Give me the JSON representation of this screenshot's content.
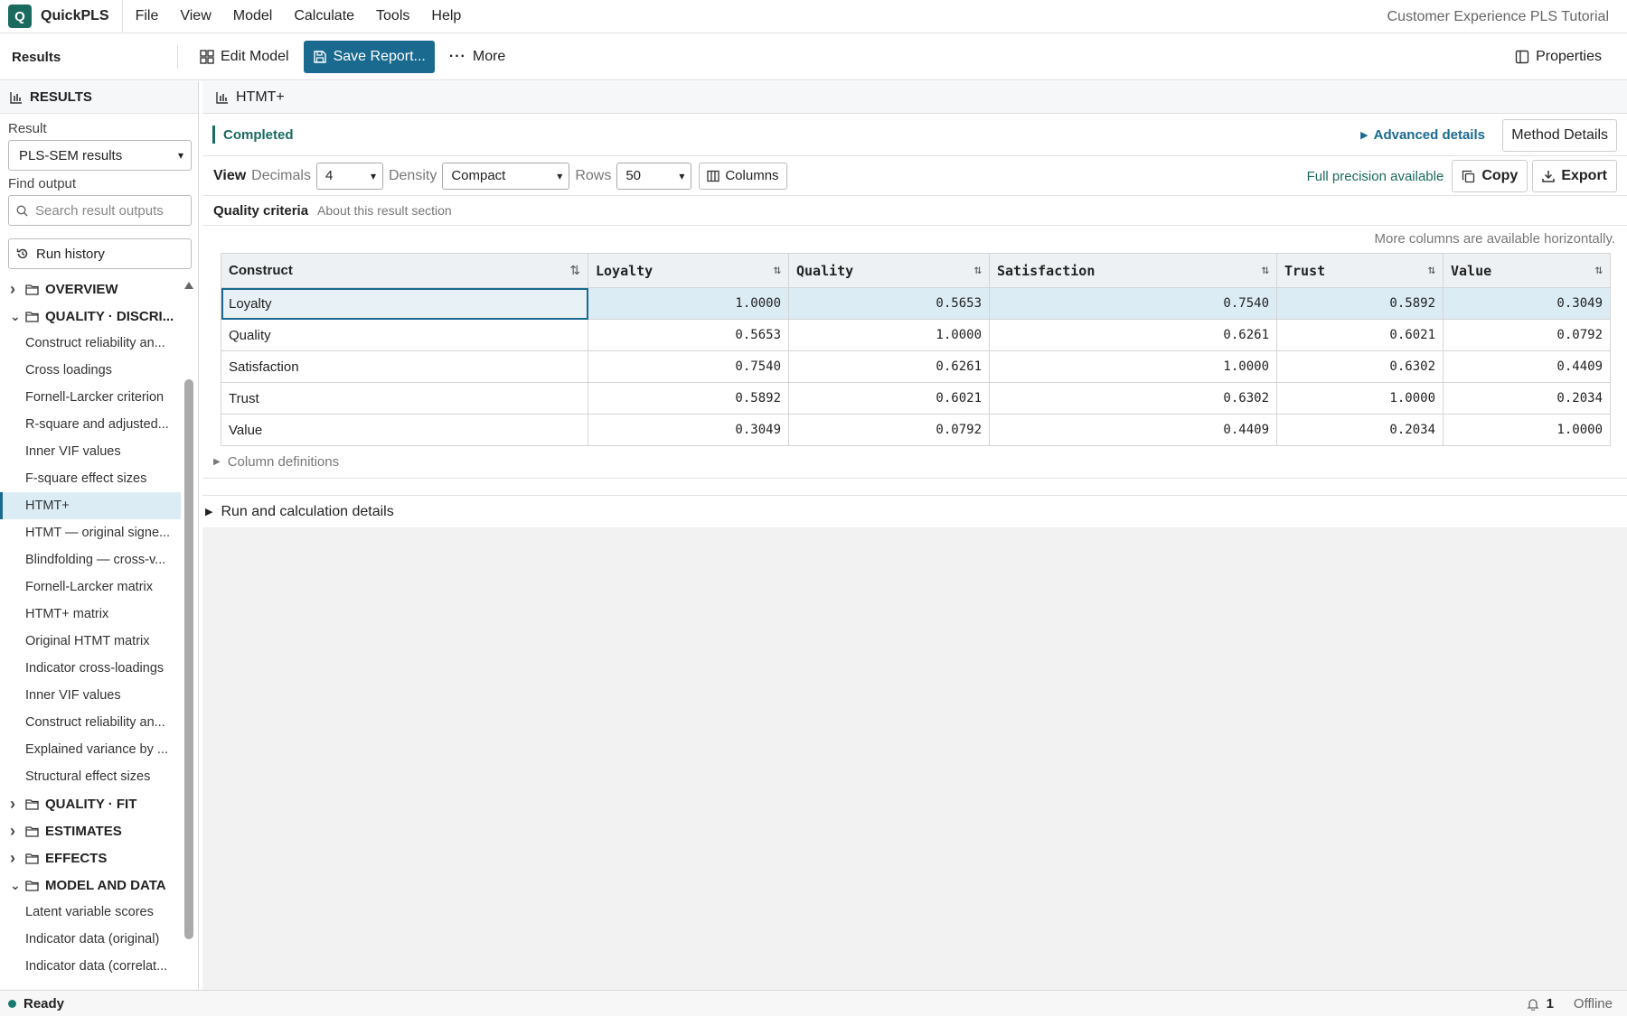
{
  "app": {
    "name": "QuickPLS",
    "logo_letter": "Q",
    "project_title": "Customer Experience PLS Tutorial"
  },
  "menu": [
    "File",
    "View",
    "Model",
    "Calculate",
    "Tools",
    "Help"
  ],
  "toolbar": {
    "title": "Results",
    "edit_model": "Edit Model",
    "save_report": "Save Report...",
    "more": "More",
    "properties": "Properties"
  },
  "sidebar": {
    "header": "RESULTS",
    "result_label": "Result",
    "result_value": "PLS-SEM results",
    "find_label": "Find output",
    "search_placeholder": "Search result outputs",
    "run_history": "Run history",
    "tree": [
      {
        "type": "folder",
        "label": "OVERVIEW",
        "expanded": false
      },
      {
        "type": "folder",
        "label": "QUALITY · DISCRI...",
        "expanded": true
      },
      {
        "type": "item",
        "label": "Construct reliability an..."
      },
      {
        "type": "item",
        "label": "Cross loadings"
      },
      {
        "type": "item",
        "label": "Fornell-Larcker criterion"
      },
      {
        "type": "item",
        "label": "R-square and adjusted..."
      },
      {
        "type": "item",
        "label": "Inner VIF values"
      },
      {
        "type": "item",
        "label": "F-square effect sizes"
      },
      {
        "type": "item",
        "label": "HTMT+",
        "active": true
      },
      {
        "type": "item",
        "label": "HTMT — original signe..."
      },
      {
        "type": "item",
        "label": "Blindfolding — cross-v..."
      },
      {
        "type": "item",
        "label": "Fornell-Larcker matrix"
      },
      {
        "type": "item",
        "label": "HTMT+ matrix"
      },
      {
        "type": "item",
        "label": "Original HTMT matrix"
      },
      {
        "type": "item",
        "label": "Indicator cross-loadings"
      },
      {
        "type": "item",
        "label": "Inner VIF values"
      },
      {
        "type": "item",
        "label": "Construct reliability an..."
      },
      {
        "type": "item",
        "label": "Explained variance by ..."
      },
      {
        "type": "item",
        "label": "Structural effect sizes"
      },
      {
        "type": "folder",
        "label": "QUALITY · FIT",
        "expanded": false
      },
      {
        "type": "folder",
        "label": "ESTIMATES",
        "expanded": false
      },
      {
        "type": "folder",
        "label": "EFFECTS",
        "expanded": false
      },
      {
        "type": "folder",
        "label": "MODEL AND DATA",
        "expanded": true
      },
      {
        "type": "item",
        "label": "Latent variable scores"
      },
      {
        "type": "item",
        "label": "Indicator data (original)"
      },
      {
        "type": "item",
        "label": "Indicator data (correlat..."
      }
    ]
  },
  "main": {
    "header": "HTMT+",
    "status": "Completed",
    "advanced_details": "Advanced details",
    "method_details": "Method Details",
    "view": {
      "label": "View",
      "decimals_label": "Decimals",
      "decimals_value": "4",
      "density_label": "Density",
      "density_value": "Compact",
      "rows_label": "Rows",
      "rows_value": "50",
      "columns_button": "Columns",
      "full_precision": "Full precision available",
      "copy": "Copy",
      "export": "Export"
    },
    "section": {
      "title": "Quality criteria",
      "about": "About this result section"
    },
    "hscroll_note": "More columns are available horizontally.",
    "table": {
      "columns": [
        "Construct",
        "Loyalty",
        "Quality",
        "Satisfaction",
        "Trust",
        "Value"
      ],
      "rows": [
        [
          "Loyalty",
          "1.0000",
          "0.5653",
          "0.7540",
          "0.5892",
          "0.3049"
        ],
        [
          "Quality",
          "0.5653",
          "1.0000",
          "0.6261",
          "0.6021",
          "0.0792"
        ],
        [
          "Satisfaction",
          "0.7540",
          "0.6261",
          "1.0000",
          "0.6302",
          "0.4409"
        ],
        [
          "Trust",
          "0.5892",
          "0.6021",
          "0.6302",
          "1.0000",
          "0.2034"
        ],
        [
          "Value",
          "0.3049",
          "0.0792",
          "0.4409",
          "0.2034",
          "1.0000"
        ]
      ],
      "selected_row": 0
    },
    "column_definitions": "Column definitions",
    "run_details": "Run and calculation details"
  },
  "statusbar": {
    "ready": "Ready",
    "notifications": "1",
    "connection": "Offline"
  }
}
